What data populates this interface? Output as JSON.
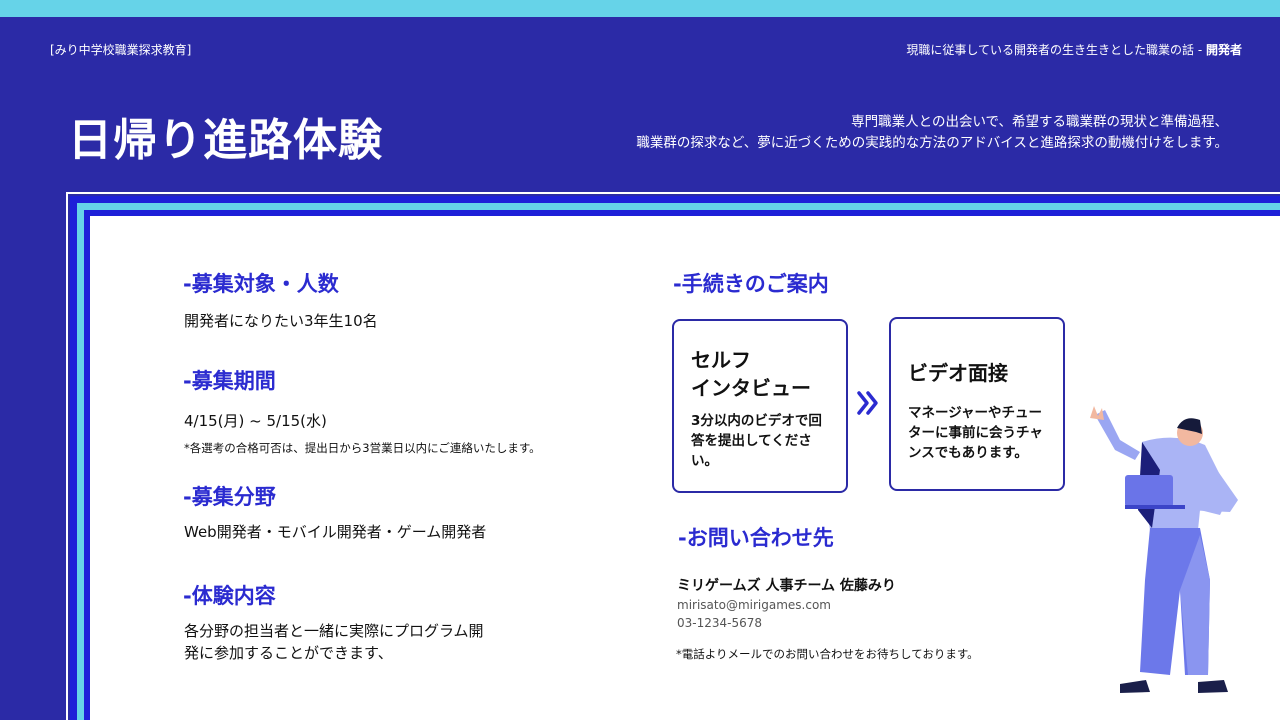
{
  "header": {
    "org": "[みり中学校職業探求教育]",
    "tagline": "現職に従事している開発者の生き生きとした職業の話 - ",
    "tagline_bold": "開発者"
  },
  "title": "日帰り進路体験",
  "lead": {
    "line1": "専門職業人との出会いで、希望する職業群の現状と準備過程、",
    "line2": "職業群の探求など、夢に近づくための実践的な方法のアドバイスと進路探求の動機付けをします。"
  },
  "recruit_target": {
    "heading": "-募集対象・人数",
    "text": "開発者になりたい3年生10名"
  },
  "recruit_period": {
    "heading": "-募集期間",
    "dates": "4/15(月) ~ 5/15(水)",
    "note": "*各選考の合格可否は、提出日から3営業日以内にご連絡いたします。"
  },
  "recruit_field": {
    "heading": "-募集分野",
    "text": "Web開発者・モバイル開発者・ゲーム開発者"
  },
  "experience": {
    "heading": "-体験内容",
    "line1": "各分野の担当者と一緒に実際にプログラム開",
    "line2": "発に参加することができます、"
  },
  "procedure": {
    "heading": "-手続きのご案内",
    "step1_title_1": "セルフ",
    "step1_title_2": "インタビュー",
    "step1_desc_1": "3分以内のビデオで回",
    "step1_desc_2": "答を提出してくださ",
    "step1_desc_3": "い。",
    "step2_title": "ビデオ面接",
    "step2_desc_1": "マネージャーやチュー",
    "step2_desc_2": "ターに事前に会うチャ",
    "step2_desc_3": "ンスでもあります。"
  },
  "contact": {
    "heading": "-お問い合わせ先",
    "name": "ミリゲームズ 人事チーム 佐藤みり",
    "email": "mirisato@mirigames.com",
    "phone": "03-1234-5678",
    "note": "*電話よりメールでのお問い合わせをお待ちしております。"
  },
  "colors": {
    "background": "#2b2aa6",
    "accent_cyan": "#66d3e8",
    "heading_blue": "#2b2bd0"
  },
  "icons": {
    "arrow": "double-chevron-right-icon",
    "illustration": "man-with-laptop-illustration"
  }
}
